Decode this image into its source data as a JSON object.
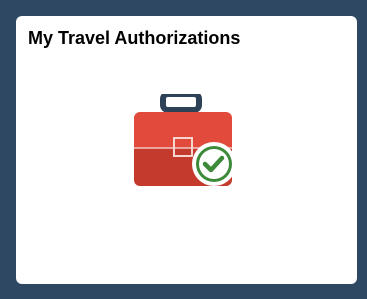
{
  "tile": {
    "title": "My Travel Authorizations",
    "icon": "briefcase-check-icon"
  },
  "colors": {
    "background": "#2e4863",
    "tile": "#ffffff",
    "briefcase_top": "#e24a3b",
    "briefcase_bottom": "#c43a2c",
    "handle": "#2d4157",
    "check_circle": "#3d8a3a"
  }
}
